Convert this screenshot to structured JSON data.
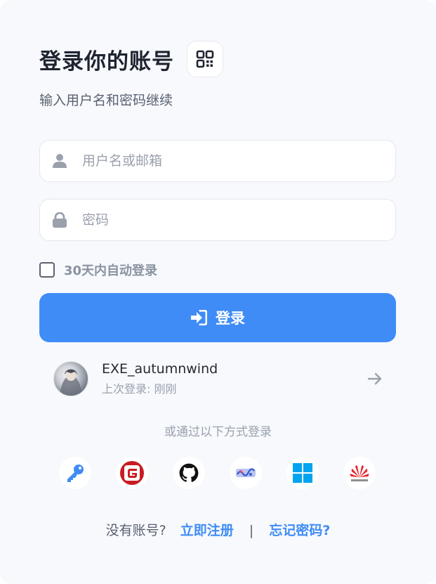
{
  "header": {
    "title": "登录你的账号",
    "qr_icon": "qr-code-icon"
  },
  "subtitle": "输入用户名和密码继续",
  "form": {
    "username": {
      "placeholder": "用户名或邮箱",
      "value": "",
      "icon": "user-icon"
    },
    "password": {
      "placeholder": "密码",
      "value": "",
      "icon": "lock-icon"
    },
    "remember_label": "30天内自动登录",
    "remember_checked": false,
    "login_label": "登录",
    "login_icon": "sign-in-icon"
  },
  "recent_account": {
    "name": "EXE_autumnwind",
    "last_login": "上次登录: 刚刚",
    "arrow_icon": "arrow-right-icon"
  },
  "alt_login_text": "或通过以下方式登录",
  "providers": [
    {
      "name": "passkey",
      "icon": "key-icon",
      "color": "#3f8cf7"
    },
    {
      "name": "gitee",
      "icon": "gitee-icon",
      "color": "#c71d23"
    },
    {
      "name": "github",
      "icon": "github-icon",
      "color": "#111111"
    },
    {
      "name": "custom",
      "icon": "anime-logo-icon",
      "color": "#3a5bd6"
    },
    {
      "name": "microsoft",
      "icon": "windows-icon",
      "color": "#00a4ef"
    },
    {
      "name": "huawei",
      "icon": "huawei-icon",
      "color": "#e8262d"
    }
  ],
  "footer": {
    "prompt": "没有账号?",
    "register_label": "立即注册",
    "separator": "|",
    "forgot_label": "忘记密码?"
  },
  "colors": {
    "accent": "#3f8cf7",
    "background": "#f7f9fc",
    "text_muted": "#9aa1ad"
  }
}
